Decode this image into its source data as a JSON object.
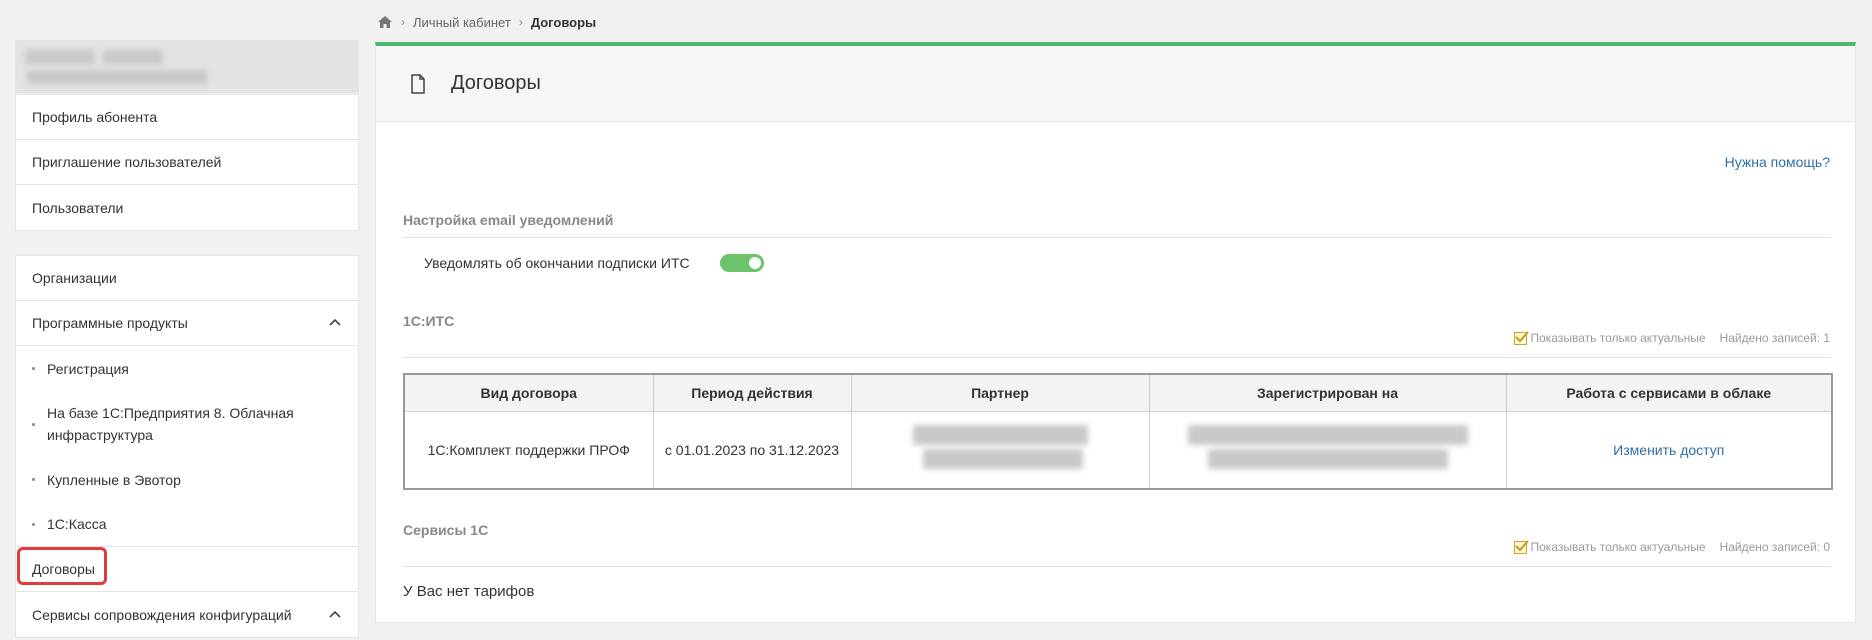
{
  "breadcrumb": {
    "home_icon": "home-icon",
    "items": [
      "Личный кабинет",
      "Договоры"
    ]
  },
  "sidebar": {
    "group1": [
      "Профиль абонента",
      "Приглашение пользователей",
      "Пользователи"
    ],
    "group2": {
      "organizations": "Организации",
      "software_products": "Программные продукты",
      "sub_items": [
        "Регистрация",
        "На базе 1С:Предприятия 8. Облачная инфраструктура",
        "Купленные в Эвотор",
        "1С:Касса"
      ],
      "contracts": "Договоры",
      "config_services": "Сервисы сопровождения конфигураций"
    }
  },
  "panel": {
    "title": "Договоры",
    "help_link": "Нужна помощь?",
    "email_section": "Настройка email уведомлений",
    "notify_label": "Уведомлять об окончании подписки ИТС",
    "notify_enabled": true,
    "itc_section": "1С:ИТС",
    "itc_filter": "Показывать только актуальные",
    "itc_found": "Найдено записей: 1",
    "itc_table": {
      "headers": [
        "Вид договора",
        "Период действия",
        "Партнер",
        "Зарегистрирован на",
        "Работа с сервисами в облаке"
      ],
      "rows": [
        {
          "type": "1С:Комплект поддержки ПРОФ",
          "period": "с 01.01.2023 по 31.12.2023",
          "action": "Изменить доступ"
        }
      ]
    },
    "services_section": "Сервисы 1С",
    "services_filter": "Показывать только актуальные",
    "services_found": "Найдено записей: 0",
    "no_tariffs": "У Вас нет тарифов"
  },
  "colors": {
    "accent_green": "#4cb86b",
    "toggle_green": "#6cc36b",
    "link_blue": "#2f6fa8",
    "highlight_red": "#e03c3c"
  }
}
